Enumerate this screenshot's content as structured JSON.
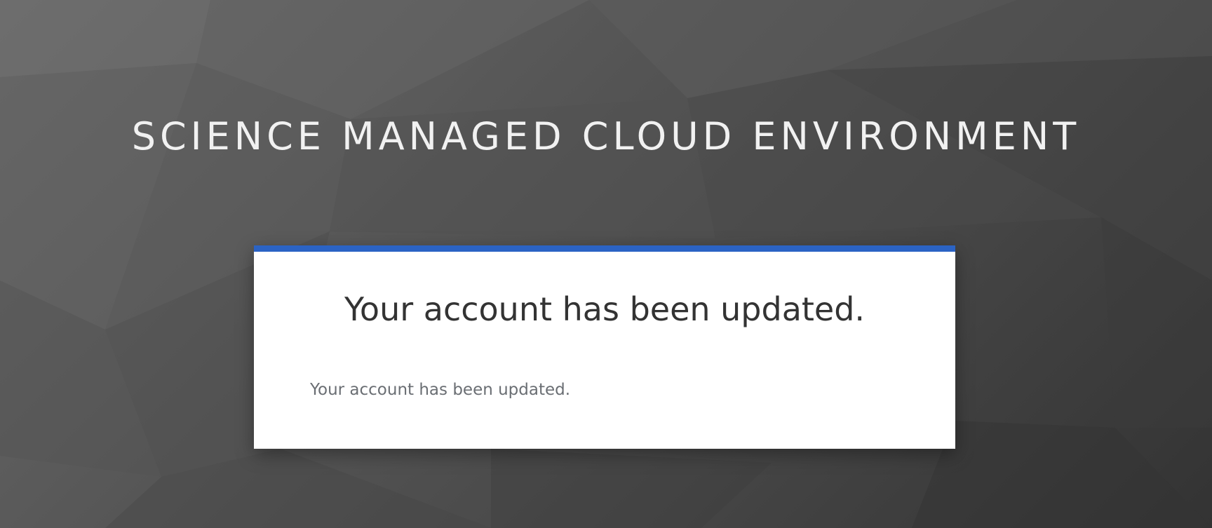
{
  "header": {
    "realm_title": "SCIENCE MANAGED CLOUD ENVIRONMENT"
  },
  "card": {
    "title": "Your account has been updated.",
    "message": "Your account has been updated.",
    "accent_color": "#2b63c4"
  }
}
